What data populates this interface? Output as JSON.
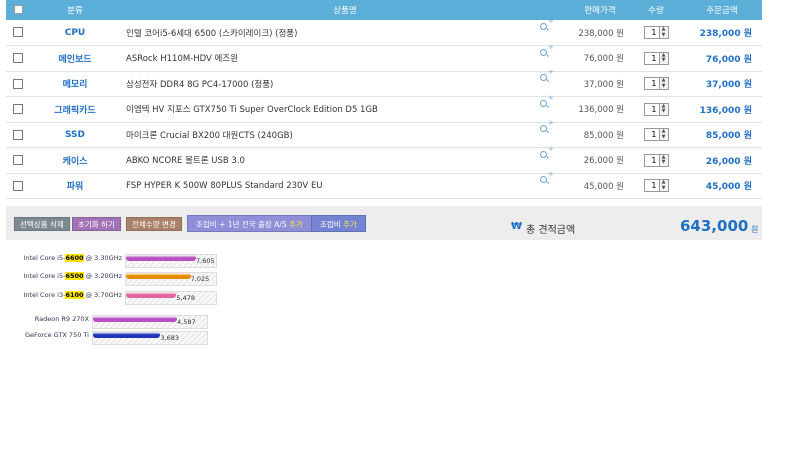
{
  "header": {
    "category": "분류",
    "product": "상품명",
    "price": "판매가격",
    "qty": "수량",
    "total": "주문금액"
  },
  "rows": [
    {
      "category": "CPU",
      "name": "인텔 코어i5-6세대 6500 (스카이레이크) (정품)",
      "price": "238,000 원",
      "qty": "1",
      "total": "238,000 원"
    },
    {
      "category": "메인보드",
      "name": "ASRock H110M-HDV 에즈윈",
      "price": "76,000 원",
      "qty": "1",
      "total": "76,000 원"
    },
    {
      "category": "메모리",
      "name": "삼성전자 DDR4 8G PC4-17000 (정품)",
      "price": "37,000 원",
      "qty": "1",
      "total": "37,000 원"
    },
    {
      "category": "그래픽카드",
      "name": "이엠텍 HV 지포스 GTX750 Ti Super OverClock Edition D5 1GB",
      "price": "136,000 원",
      "qty": "1",
      "total": "136,000 원"
    },
    {
      "category": "SSD",
      "name": "마이크론 Crucial BX200 대원CTS (240GB)",
      "price": "85,000 원",
      "qty": "1",
      "total": "85,000 원"
    },
    {
      "category": "케이스",
      "name": "ABKO NCORE 볼트론 USB 3.0",
      "price": "26,000 원",
      "qty": "1",
      "total": "26,000 원"
    },
    {
      "category": "파워",
      "name": "FSP HYPER K 500W 80PLUS Standard 230V EU",
      "price": "45,000 원",
      "qty": "1",
      "total": "45,000 원"
    }
  ],
  "actions": {
    "delete_selected": "선택상품 삭제",
    "reset": "초기화 하기",
    "change_all_qty": "전체수량 변경",
    "assemble_as_prefix": "조립비 + 1년 전국 출장 A/S",
    "assemble_as_suffix": "추가",
    "assemble_prefix": "조립비",
    "assemble_suffix": "추가"
  },
  "summary": {
    "won_symbol": "₩",
    "label": "총 견적금액",
    "amount": "643,000",
    "unit": "원"
  },
  "benchmarks": [
    {
      "pre": "Intel Core i5-",
      "hl": "6600",
      "post": " @ 3.30GHz",
      "value": 7605,
      "value_text": "7,605",
      "color": "#b94fc2"
    },
    {
      "pre": "Intel Core i5-",
      "hl": "6500",
      "post": " @ 3.20GHz",
      "value": 7025,
      "value_text": "7,025",
      "color": "#e68a00"
    },
    {
      "pre": "Intel Core i3-",
      "hl": "6100",
      "post": " @ 3.70GHz",
      "value": 5478,
      "value_text": "5,478",
      "color": "#e0669c"
    },
    {
      "pre": "Radeon R9 270X",
      "hl": "",
      "post": "",
      "value": 4587,
      "value_text": "4,587",
      "color": "#b94fc2"
    },
    {
      "pre": "GeForce GTX 750 Ti",
      "hl": "",
      "post": "",
      "value": 3683,
      "value_text": "3,683",
      "color": "#2233b8"
    }
  ],
  "colors": {
    "header_bg": "#5baed8",
    "accent_blue": "#1f6fc5"
  },
  "icons": {
    "zoom": "zoom-plus-icon",
    "won": "won-icon"
  }
}
